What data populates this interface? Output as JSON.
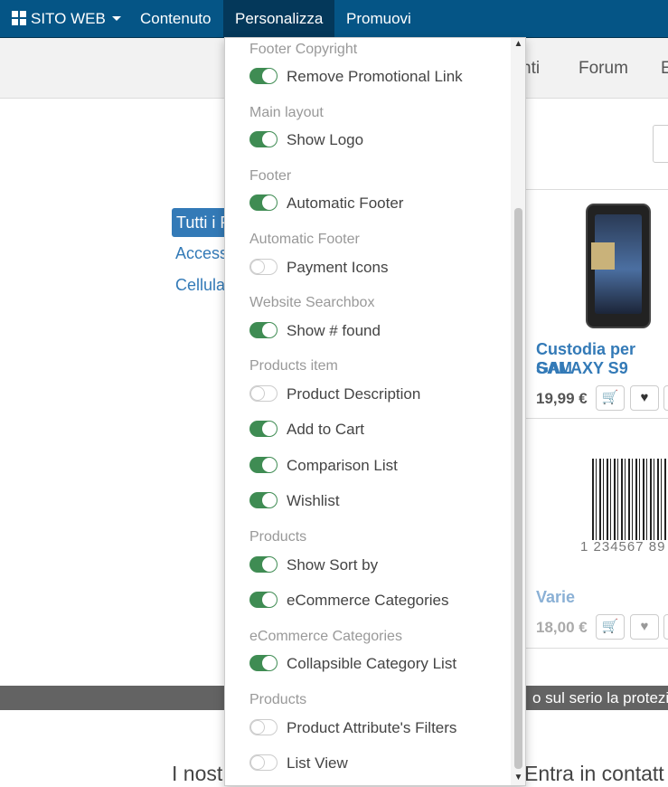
{
  "topbar": {
    "site_label": "SITO WEB",
    "menu": [
      "Contenuto",
      "Personalizza",
      "Promuovi"
    ],
    "active": "Personalizza"
  },
  "header": {
    "nav": [
      "nti",
      "Forum",
      "E"
    ]
  },
  "categories": {
    "active": "Tutti i P",
    "items": [
      "Access",
      "Cellula"
    ]
  },
  "products": [
    {
      "title_line1": "Custodia per SAM",
      "title_line2": "GALAXY S9",
      "price": "19,99 €"
    },
    {
      "title_line1": "Varie",
      "price": "18,00 €",
      "barcode_number": "1 234567 89"
    }
  ],
  "footer": {
    "bar_text": "o sul serio la protezio",
    "bottom_left": "I nost",
    "bottom_right": "Entra in contatt"
  },
  "customize": {
    "sections": [
      {
        "title": "Footer Copyright",
        "options": [
          {
            "label": "Remove Promotional Link",
            "on": true
          }
        ]
      },
      {
        "title": "Main layout",
        "options": [
          {
            "label": "Show Logo",
            "on": true
          }
        ]
      },
      {
        "title": "Footer",
        "options": [
          {
            "label": "Automatic Footer",
            "on": true
          }
        ]
      },
      {
        "title": "Automatic Footer",
        "options": [
          {
            "label": "Payment Icons",
            "on": false
          }
        ]
      },
      {
        "title": "Website Searchbox",
        "options": [
          {
            "label": "Show # found",
            "on": true
          }
        ]
      },
      {
        "title": "Products item",
        "options": [
          {
            "label": "Product Description",
            "on": false
          },
          {
            "label": "Add to Cart",
            "on": true
          },
          {
            "label": "Comparison List",
            "on": true
          },
          {
            "label": "Wishlist",
            "on": true
          }
        ]
      },
      {
        "title": "Products",
        "options": [
          {
            "label": "Show Sort by",
            "on": true
          },
          {
            "label": "eCommerce Categories",
            "on": true
          }
        ]
      },
      {
        "title": "eCommerce Categories",
        "options": [
          {
            "label": "Collapsible Category List",
            "on": true
          }
        ]
      },
      {
        "title": "Products",
        "options": [
          {
            "label": "Product Attribute's Filters",
            "on": false
          },
          {
            "label": "List View",
            "on": false
          }
        ]
      }
    ]
  },
  "colors": {
    "admin_bar": "#055586",
    "toggle_on": "#3f8c53",
    "link": "#337ab7"
  }
}
